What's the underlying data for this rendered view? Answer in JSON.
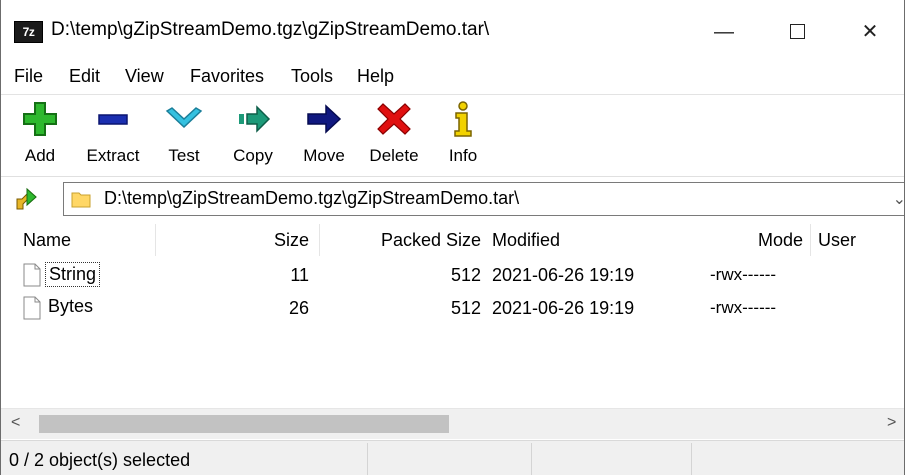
{
  "window": {
    "app_icon_text": "7z",
    "title": "D:\\temp\\gZipStreamDemo.tgz\\gZipStreamDemo.tar\\",
    "minimize_label": "—",
    "close_label": "✕"
  },
  "menu": {
    "items": [
      "File",
      "Edit",
      "View",
      "Favorites",
      "Tools",
      "Help"
    ]
  },
  "toolbar": {
    "buttons": [
      {
        "label": "Add",
        "icon": "add-plus-icon",
        "color": "#2eb82e"
      },
      {
        "label": "Extract",
        "icon": "extract-minus-icon",
        "color": "#1b2fb0"
      },
      {
        "label": "Test",
        "icon": "test-check-icon",
        "color": "#35c1e0"
      },
      {
        "label": "Copy",
        "icon": "copy-arrow-icon",
        "color": "#1d9a79"
      },
      {
        "label": "Move",
        "icon": "move-arrow-icon",
        "color": "#101880"
      },
      {
        "label": "Delete",
        "icon": "delete-x-icon",
        "color": "#e01010"
      },
      {
        "label": "Info",
        "icon": "info-icon",
        "color": "#c8a200"
      }
    ]
  },
  "address": {
    "path": "D:\\temp\\gZipStreamDemo.tgz\\gZipStreamDemo.tar\\"
  },
  "list": {
    "columns": [
      "Name",
      "Size",
      "Packed Size",
      "Modified",
      "Mode",
      "User"
    ],
    "rows": [
      {
        "name": "String",
        "size": "11",
        "packed": "512",
        "modified": "2021-06-26 19:19",
        "mode": "-rwx------"
      },
      {
        "name": "Bytes",
        "size": "26",
        "packed": "512",
        "modified": "2021-06-26 19:19",
        "mode": "-rwx------"
      }
    ]
  },
  "scrollbar": {
    "left_arrow": "<",
    "right_arrow": ">"
  },
  "status": {
    "selection": "0 / 2 object(s) selected"
  }
}
